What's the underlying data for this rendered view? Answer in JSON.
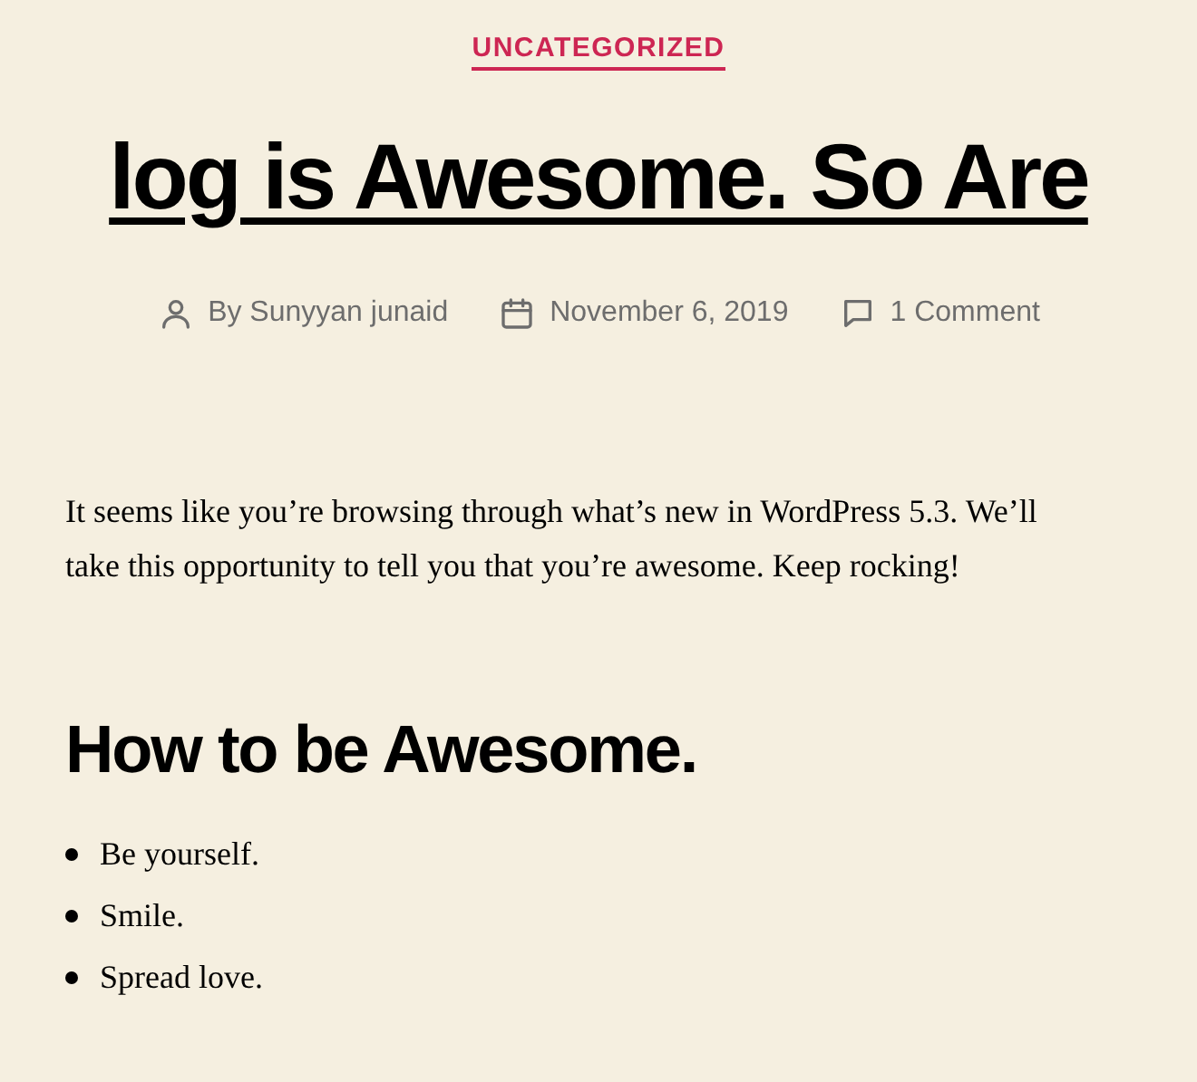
{
  "category": "UNCATEGORIZED",
  "title": "log is Awesome. So Are",
  "meta": [
    {
      "kind": "author",
      "text": "By Sunyyan junaid"
    },
    {
      "kind": "date",
      "text": "November 6, 2019"
    },
    {
      "kind": "comments",
      "text": "1 Comment"
    }
  ],
  "paragraph": "It seems like you’re browsing through what’s new in WordPress 5.3. We’ll take this opportunity to tell you that you’re awesome. Keep rocking!",
  "heading": "How to be Awesome.",
  "list": [
    "Be yourself.",
    "Smile.",
    "Spread love."
  ]
}
